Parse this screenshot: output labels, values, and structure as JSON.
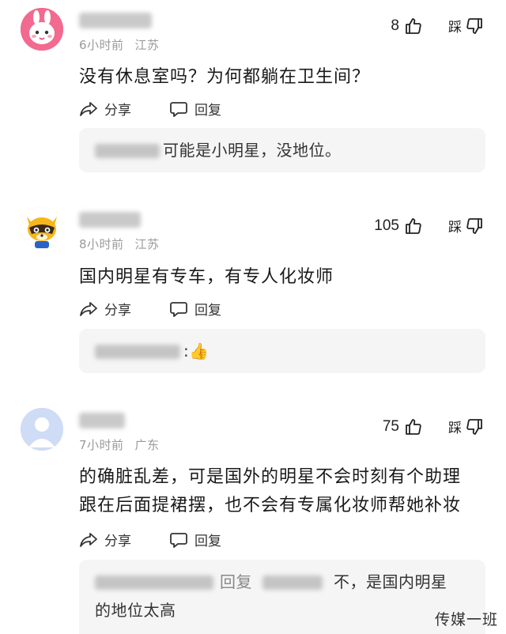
{
  "comments": [
    {
      "meta": "6小时前",
      "location": "江苏",
      "likes": "8",
      "dislike_label": "踩",
      "text": "没有休息室吗？为何都躺在卫生间？",
      "share_label": "分享",
      "reply_label": "回复",
      "reply_preview": "可能是小明星，没地位。"
    },
    {
      "meta": "8小时前",
      "location": "江苏",
      "likes": "105",
      "dislike_label": "踩",
      "text": "国内明星有专车，有专人化妆师",
      "share_label": "分享",
      "reply_label": "回复",
      "reply_preview": ":👍"
    },
    {
      "meta": "7小时前",
      "location": "广东",
      "likes": "75",
      "dislike_label": "踩",
      "text_line1": "的确脏乱差，可是国外的明星不会时刻有个助理",
      "text_line2": "跟在后面提裙摆，也不会有专属化妆师帮她补妆",
      "share_label": "分享",
      "reply_label": "回复",
      "reply_verb": "回复",
      "reply_preview_line1": "不，是国内明星",
      "reply_preview_line2": "的地位太高"
    }
  ],
  "watermark": "传媒一班",
  "icons": {
    "like": "thumbs-up-icon",
    "dislike": "thumbs-down-icon",
    "share": "share-icon",
    "reply": "reply-bubble-icon"
  },
  "colors": {
    "meta": "#9a9a9a",
    "reply_bg": "#f5f5f5",
    "avatar1": "#f0628a",
    "avatar3": "#c9d8f5"
  }
}
